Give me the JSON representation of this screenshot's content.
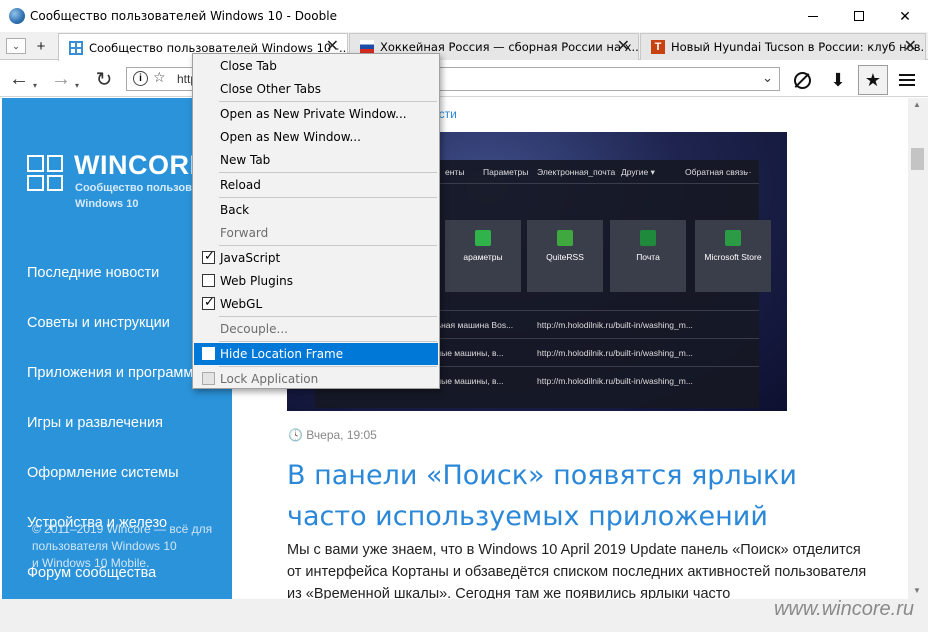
{
  "window": {
    "title": "Сообщество пользователей Windows 10 - Dooble",
    "minimize": "",
    "maximize": "",
    "close": "✕"
  },
  "tabs": {
    "list_btn": "⌄",
    "new_btn": "+",
    "items": [
      {
        "label": "Сообщество пользователей Windows 10 -...",
        "close": "✕"
      },
      {
        "label": "Хоккейная Россия — сборная России на х...",
        "close": "✕"
      },
      {
        "label": "Новый Hyundai Tucson в России: клуб нов...",
        "close": "✕",
        "icon_text": "T"
      }
    ]
  },
  "toolbar": {
    "back": "←",
    "forward": "→",
    "reload": "↻",
    "dropdown": "▾",
    "url_info": "i",
    "url_star": "☆",
    "url_text": "http",
    "url_dropdown": "⌄",
    "download": "⬇",
    "bookmark": "★"
  },
  "menu": {
    "items": [
      {
        "label": "Close Tab"
      },
      {
        "label": "Close Other Tabs"
      },
      {
        "label": "Open as New Private Window..."
      },
      {
        "label": "Open as New Window..."
      },
      {
        "label": "New Tab"
      },
      {
        "label": "Reload"
      },
      {
        "label": "Back"
      },
      {
        "label": "Forward"
      },
      {
        "label": "JavaScript"
      },
      {
        "label": "Web Plugins"
      },
      {
        "label": "WebGL"
      },
      {
        "label": "Decouple..."
      },
      {
        "label": "Hide Location Frame"
      },
      {
        "label": "Lock Application"
      }
    ]
  },
  "sidebar": {
    "logo": "WINCORE",
    "logo_sub1": "Сообщество пользов",
    "logo_sub2": "Windows 10",
    "nav": [
      "Последние новости",
      "Советы и инструкции",
      "Приложения и программ",
      "Игры и развлечения",
      "Оформление системы",
      "Устройства и железо",
      "Форум сообщества"
    ],
    "footer": [
      "© 2011–2019 Wincore — всё для",
      "пользователя Windows 10",
      "и Windows 10 Mobile."
    ]
  },
  "article": {
    "breadcrumb": "ости",
    "date": "Вчера, 19:05",
    "title": "В панели «Поиск» появятся ярлыки часто используемых приложений",
    "text": "Мы с вами уже знаем, что в Windows 10 April 2019 Update панель «Поиск» отделится от интерфейса Кортаны и обзаведётся списком последних активностей пользователя из «Временной шкалы». Сегодня там же появились ярлыки часто"
  },
  "hero": {
    "topbar": [
      "енты",
      "Параметры",
      "Электронная_почта",
      "Другие ▾",
      "Обратная связь",
      "···"
    ],
    "tiles": [
      "араметры",
      "QuiteRSS",
      "Почта",
      "Microsoft Store"
    ],
    "rows": [
      {
        "name": "альная машина Bos...",
        "url": "http://m.holodilnik.ru/built-in/washing_m..."
      },
      {
        "name": "льные машины, в...",
        "url": "http://m.holodilnik.ru/built-in/washing_m..."
      },
      {
        "name": "льные машины, в...",
        "url": "http://m.holodilnik.ru/built-in/washing_m..."
      }
    ]
  },
  "watermark": "www.wincore.ru"
}
